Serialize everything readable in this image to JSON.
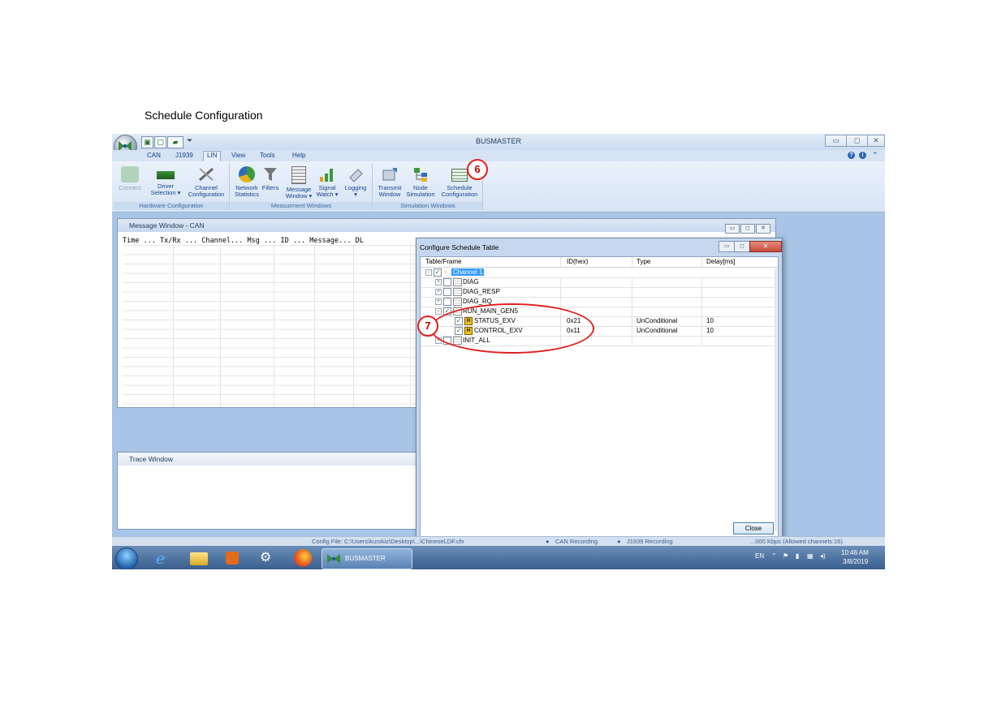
{
  "heading": "Schedule Configuration",
  "app": {
    "title": "BUSMASTER",
    "tabs": [
      "CAN",
      "J1939",
      "LIN",
      "View",
      "Tools",
      "Help"
    ],
    "active_tab": "LIN"
  },
  "ribbon": {
    "groups": [
      {
        "label": "Hardware Configuration",
        "buttons": [
          {
            "label1": "Connect",
            "label2": ""
          },
          {
            "label1": "Driver",
            "label2": "Selection ▾"
          },
          {
            "label1": "Channel",
            "label2": "Configuration"
          }
        ]
      },
      {
        "label": "Measurment Windows",
        "buttons": [
          {
            "label1": "Network",
            "label2": "Statistics"
          },
          {
            "label1": "Filters",
            "label2": ""
          },
          {
            "label1": "Message",
            "label2": "Window ▾"
          },
          {
            "label1": "Signal",
            "label2": "Watch ▾"
          },
          {
            "label1": "Logging",
            "label2": "▾"
          }
        ]
      },
      {
        "label": "Simulation Windows",
        "buttons": [
          {
            "label1": "Transmit",
            "label2": "Window"
          },
          {
            "label1": "Node",
            "label2": "Simulation"
          },
          {
            "label1": "Schedule",
            "label2": "Configuration"
          }
        ]
      }
    ]
  },
  "message_window": {
    "title": "Message Window - CAN",
    "columns": "Time     ...  Tx/Rx  ...  Channel...  Msg   ...  ID   ...  Message...  DL"
  },
  "trace_window": {
    "title": "Trace Window"
  },
  "dialog": {
    "title": "Configure Schedule Table",
    "columns": {
      "frame": "Table/Frame",
      "id": "ID(hex)",
      "type": "Type",
      "delay": "Delay[ms]"
    },
    "rows": [
      {
        "label": "Channel 1",
        "id": "",
        "type": "",
        "delay": ""
      },
      {
        "label": "DIAG",
        "id": "",
        "type": "",
        "delay": ""
      },
      {
        "label": "DIAG_RESP",
        "id": "",
        "type": "",
        "delay": ""
      },
      {
        "label": "DIAG_RQ",
        "id": "",
        "type": "",
        "delay": ""
      },
      {
        "label": "RUN_MAIN_GEN5",
        "id": "",
        "type": "",
        "delay": ""
      },
      {
        "label": "STATUS_EXV",
        "id": "0x21",
        "type": "UnConditional",
        "delay": "10"
      },
      {
        "label": "CONTROL_EXV",
        "id": "0x11",
        "type": "UnConditional",
        "delay": "10"
      },
      {
        "label": "INIT_ALL",
        "id": "",
        "type": "",
        "delay": ""
      }
    ],
    "close_label": "Close"
  },
  "status": {
    "config_file": "Config File: C:\\Users\\kurokiz\\Desktop\\...\\ChineseLDF.cfx",
    "can_recording": "CAN Recording",
    "j1939_recording": "J1939 Recording",
    "channels": "...000 Kbps (Allowed channels:16)"
  },
  "taskbar": {
    "active_app": "BUSMASTER",
    "lang": "EN",
    "time": "10:46 AM",
    "date": "3/8/2019"
  },
  "annotations": [
    "6",
    "7"
  ],
  "colors": {
    "annotation": "#e02020",
    "selection": "#3399ff",
    "ribbon_text": "#15428b"
  }
}
